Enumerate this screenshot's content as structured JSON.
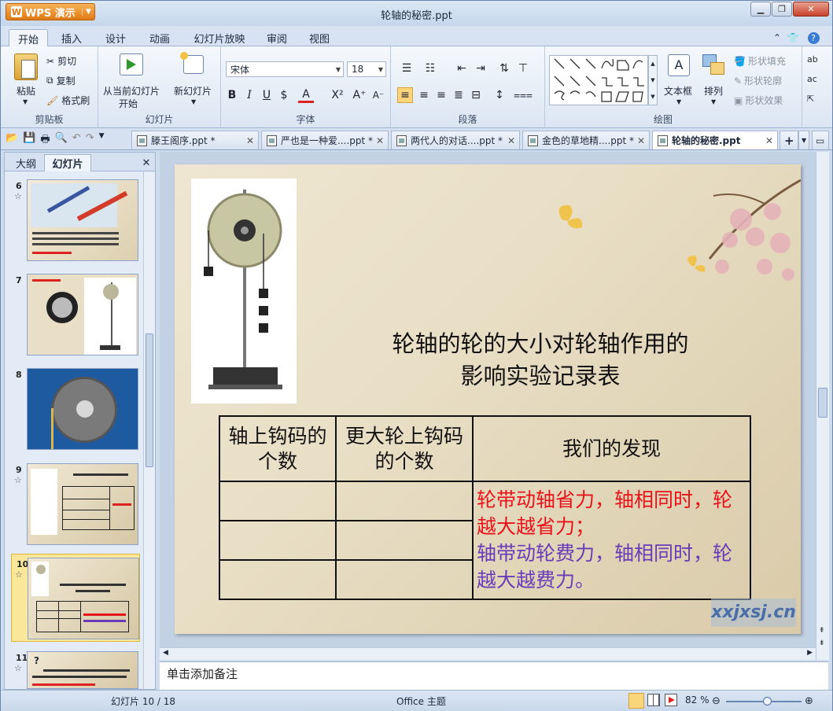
{
  "window": {
    "title": "轮轴的秘密.ppt",
    "app_label": "WPS 演示",
    "minimize": "▁",
    "restore": "❐",
    "close": "✕"
  },
  "menu": {
    "tabs": [
      "开始",
      "插入",
      "设计",
      "动画",
      "幻灯片放映",
      "审阅",
      "视图"
    ],
    "active": "开始"
  },
  "ribbon": {
    "clipboard": {
      "paste": "粘贴",
      "cut": "剪切",
      "copy": "复制",
      "format_painter": "格式刷",
      "label": "剪贴板"
    },
    "slides": {
      "from_current": "从当前幻灯片",
      "start": "开始",
      "new_slide": "新幻灯片",
      "label": "幻灯片"
    },
    "font": {
      "name": "宋体",
      "size": "18",
      "label": "字体"
    },
    "paragraph": {
      "label": "段落"
    },
    "drawing": {
      "text_box": "文本框",
      "arrange": "排列",
      "shape_fill": "形状填充",
      "shape_outline": "形状轮廓",
      "shape_effect": "形状效果",
      "label": "绘图"
    }
  },
  "doc_tabs": [
    {
      "name": "滕王阁序.ppt *",
      "active": false
    },
    {
      "name": "严也是一种爱....ppt *",
      "active": false
    },
    {
      "name": "两代人的对话....ppt *",
      "active": false
    },
    {
      "name": "金色的草地精....ppt *",
      "active": false
    },
    {
      "name": "轮轴的秘密.ppt",
      "active": true
    }
  ],
  "left_pane": {
    "tabs": [
      "大纲",
      "幻灯片"
    ],
    "active_tab": "幻灯片",
    "thumbs": [
      {
        "num": "6",
        "star": "☆"
      },
      {
        "num": "7",
        "star": ""
      },
      {
        "num": "8",
        "star": ""
      },
      {
        "num": "9",
        "star": "☆"
      },
      {
        "num": "10",
        "star": "☆"
      },
      {
        "num": "11",
        "star": "☆"
      }
    ],
    "selected": "10"
  },
  "slide": {
    "title_line1": "轮轴的轮的大小对轮轴作用的",
    "title_line2": "影响实验记录表",
    "table": {
      "headers": [
        "轴上钩码的个数",
        "更大轮上钩码的个数",
        "我们的发现"
      ],
      "finding_red": "轮带动轴省力，轴相同时，轮越大越省力；",
      "finding_purple": "轴带动轮费力，轴相同时，轮越大越费力。"
    },
    "watermark": "xxjxsj.cn"
  },
  "notes_placeholder": "单击添加备注",
  "status": {
    "slide_pos": "幻灯片 10 / 18",
    "theme": "Office 主题",
    "zoom": "82 %",
    "zoom_level": 0.55
  },
  "colors": {
    "red_text": "#e8121a",
    "purple_text": "#6a3bb8",
    "accent": "#e07a12"
  }
}
